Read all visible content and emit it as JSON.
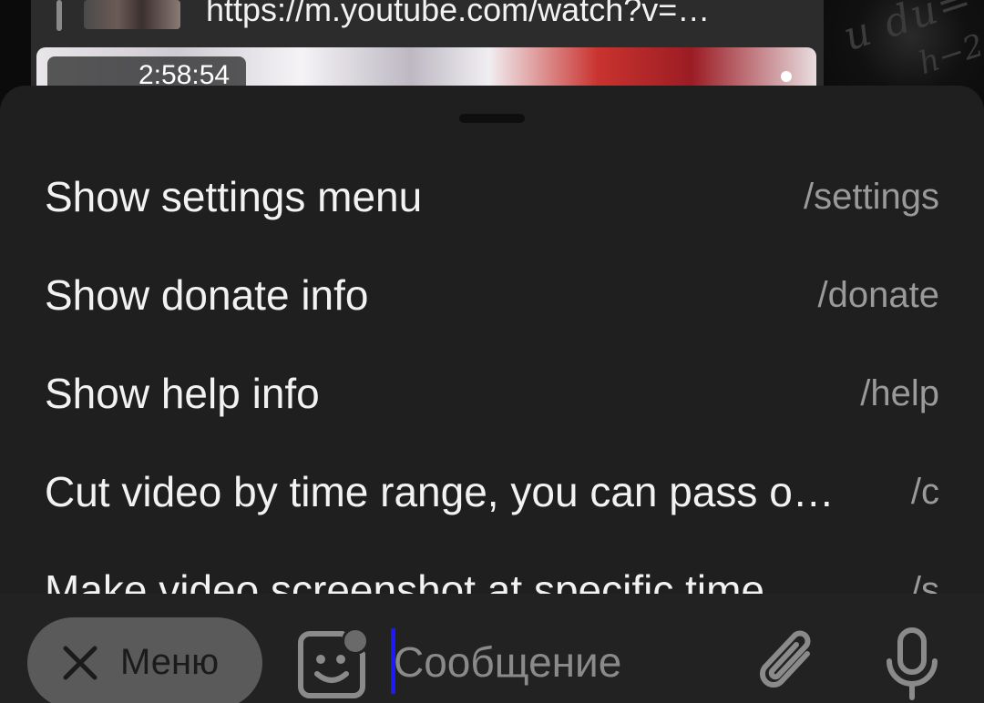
{
  "chat": {
    "link_url": "https://m.youtube.com/watch?v=…",
    "video_duration": "2:58:54"
  },
  "commands_menu": {
    "items": [
      {
        "description": "Show settings menu",
        "command": "/settings"
      },
      {
        "description": "Show donate info",
        "command": "/donate"
      },
      {
        "description": "Show help info",
        "command": "/help"
      },
      {
        "description": "Cut video by time range, you can pass o…",
        "command": "/c"
      },
      {
        "description": "Make video screenshot at specific time…",
        "command": "/s"
      }
    ]
  },
  "input_bar": {
    "menu_button_label": "Меню",
    "message_placeholder": "Сообщение",
    "icons": [
      "close-icon",
      "sticker-icon",
      "attach-icon",
      "microphone-icon"
    ]
  },
  "colors": {
    "sheet_background": "#1f1f1f",
    "input_bar_background": "#222222",
    "menu_button_background": "#5a5a5a",
    "caret": "#1a1aff",
    "command_text": "#f2f2f2",
    "command_name": "#9a9a9a"
  }
}
